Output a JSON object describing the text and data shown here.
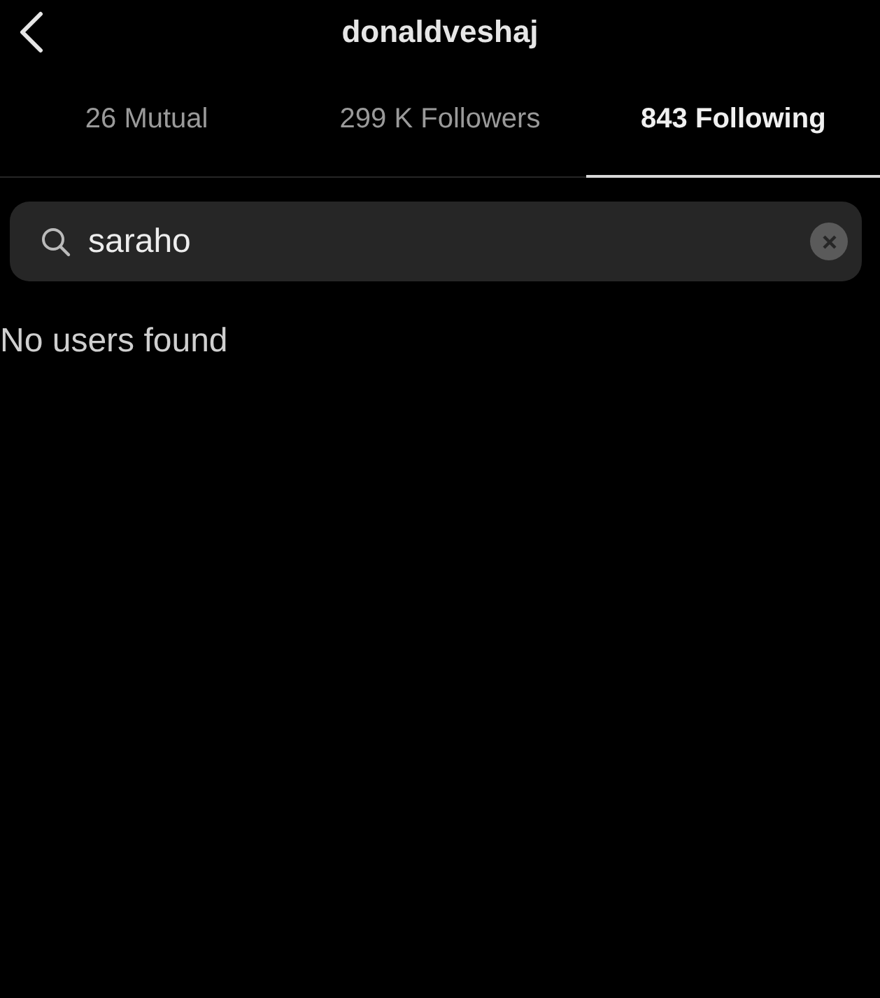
{
  "header": {
    "title": "donaldveshaj"
  },
  "tabs": [
    {
      "label": "26 Mutual",
      "selected": false
    },
    {
      "label": "299 K Followers",
      "selected": false
    },
    {
      "label": "843 Following",
      "selected": true
    }
  ],
  "search": {
    "value": "saraho"
  },
  "message": "No users found"
}
